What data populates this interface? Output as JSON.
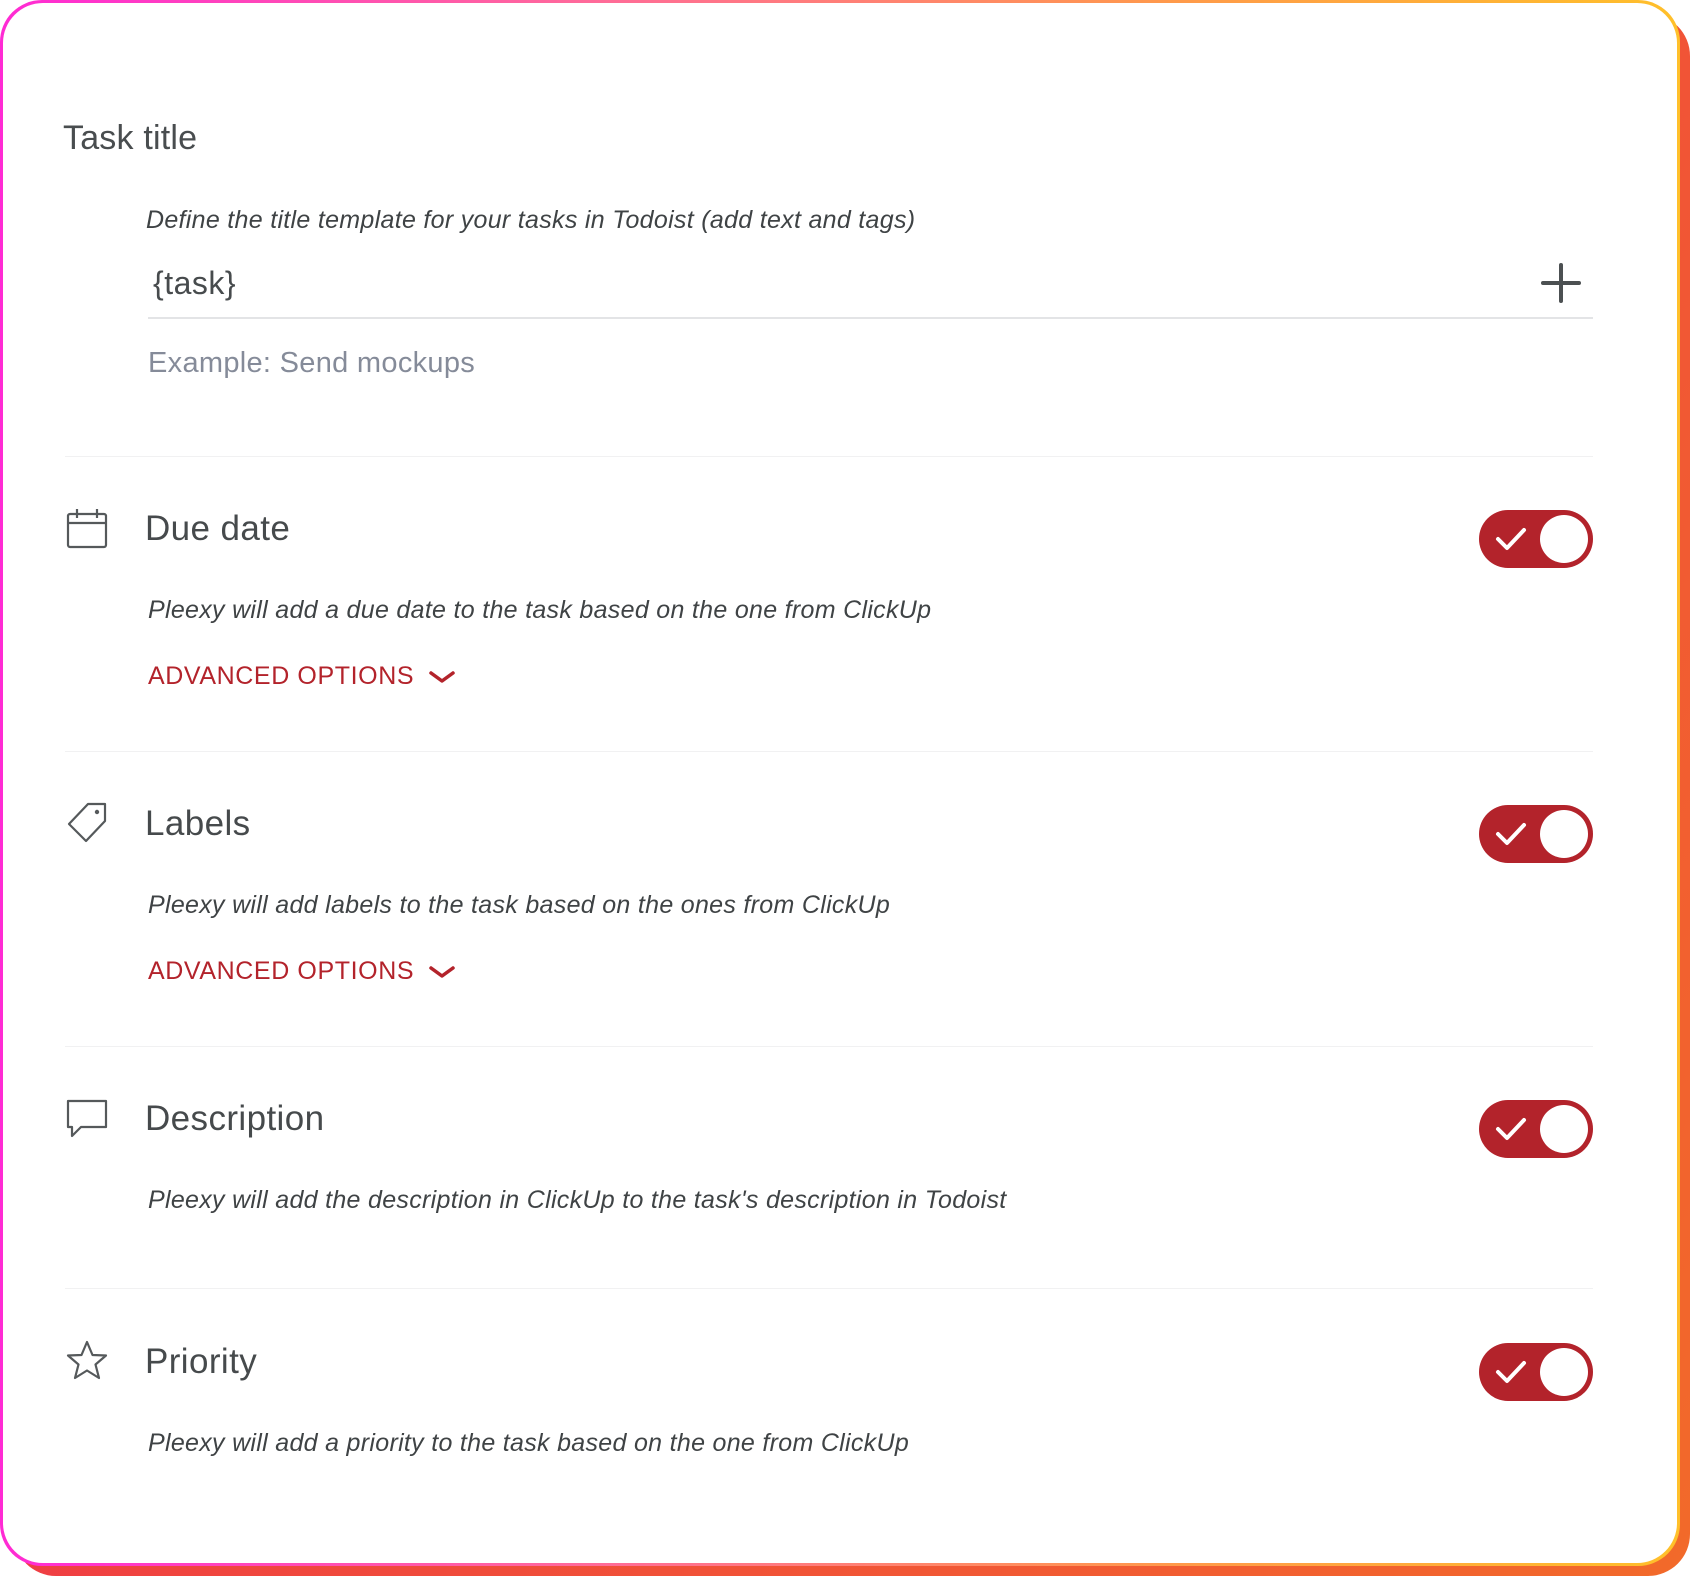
{
  "colors": {
    "accent": "#b3232b",
    "text": "#464a4c",
    "muted": "#858b99",
    "divider": "#f1f1f2"
  },
  "task_title": {
    "heading": "Task title",
    "description": "Define the title template for your tasks in Todoist (add text and tags)",
    "input_value": "{task}",
    "example": "Example: Send mockups"
  },
  "settings": [
    {
      "icon": "calendar-icon",
      "title": "Due date",
      "description": "Pleexy will add a due date to the task based on the one from ClickUp",
      "advanced_label": "ADVANCED OPTIONS",
      "enabled": true
    },
    {
      "icon": "tag-icon",
      "title": "Labels",
      "description": "Pleexy will add labels to the task based on the ones from ClickUp",
      "advanced_label": "ADVANCED OPTIONS",
      "enabled": true
    },
    {
      "icon": "comment-icon",
      "title": "Description",
      "description": "Pleexy will add the description in ClickUp to the task's description in Todoist",
      "enabled": true
    },
    {
      "icon": "star-icon",
      "title": "Priority",
      "description": "Pleexy will add a priority to the task based on the one from ClickUp",
      "enabled": true
    }
  ]
}
